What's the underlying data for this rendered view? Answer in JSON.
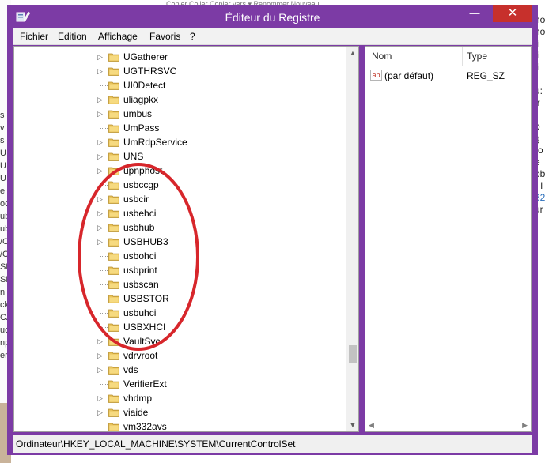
{
  "window": {
    "title": "Éditeur du Registre",
    "minimize": "—",
    "maximize": "□",
    "close": "✕"
  },
  "menu": [
    "Fichier",
    "Edition",
    "Affichage",
    "Favoris",
    "?"
  ],
  "tree": {
    "items": [
      {
        "label": "UGatherer",
        "expandable": true
      },
      {
        "label": "UGTHRSVC",
        "expandable": true
      },
      {
        "label": "UI0Detect",
        "expandable": false
      },
      {
        "label": "uliagpkx",
        "expandable": true
      },
      {
        "label": "umbus",
        "expandable": true
      },
      {
        "label": "UmPass",
        "expandable": false
      },
      {
        "label": "UmRdpService",
        "expandable": true
      },
      {
        "label": "UNS",
        "expandable": true
      },
      {
        "label": "upnphost",
        "expandable": true
      },
      {
        "label": "usbccgp",
        "expandable": false
      },
      {
        "label": "usbcir",
        "expandable": true
      },
      {
        "label": "usbehci",
        "expandable": true
      },
      {
        "label": "usbhub",
        "expandable": true
      },
      {
        "label": "USBHUB3",
        "expandable": true
      },
      {
        "label": "usbohci",
        "expandable": false
      },
      {
        "label": "usbprint",
        "expandable": false
      },
      {
        "label": "usbscan",
        "expandable": false
      },
      {
        "label": "USBSTOR",
        "expandable": false
      },
      {
        "label": "usbuhci",
        "expandable": false
      },
      {
        "label": "USBXHCI",
        "expandable": false
      },
      {
        "label": "VaultSvc",
        "expandable": true
      },
      {
        "label": "vdrvroot",
        "expandable": true
      },
      {
        "label": "vds",
        "expandable": true
      },
      {
        "label": "VerifierExt",
        "expandable": false
      },
      {
        "label": "vhdmp",
        "expandable": true
      },
      {
        "label": "viaide",
        "expandable": true
      },
      {
        "label": "vm332avs",
        "expandable": false
      }
    ]
  },
  "values_pane": {
    "columns": [
      "Nom",
      "Type"
    ],
    "rows": [
      {
        "icon": "ab",
        "name": "(par défaut)",
        "type": "REG_SZ"
      }
    ]
  },
  "status": "Ordinateur\\HKEY_LOCAL_MACHINE\\SYSTEM\\CurrentControlSet",
  "background": {
    "top_ribbon": "Copier   Coller       Copier vers ▾       Renommer       Nouveau",
    "right_lines": [
      "no",
      "no",
      "ri",
      "ri",
      "ri",
      "",
      "u:",
      "ir",
      "",
      "p",
      "g",
      "ro",
      "e",
      "ob",
      "r l",
      "32",
      "ur"
    ],
    "left_lines": [
      "s c",
      "v",
      "s U",
      "U",
      "U",
      "U",
      "e",
      "oc",
      "ub",
      "ub",
      "/C",
      "/C",
      "SE",
      "SE",
      "n C",
      "ck",
      "CA",
      "uc",
      "np",
      "er"
    ]
  },
  "annotation_color": "#d7262b",
  "accent_color": "#7c3ba5"
}
